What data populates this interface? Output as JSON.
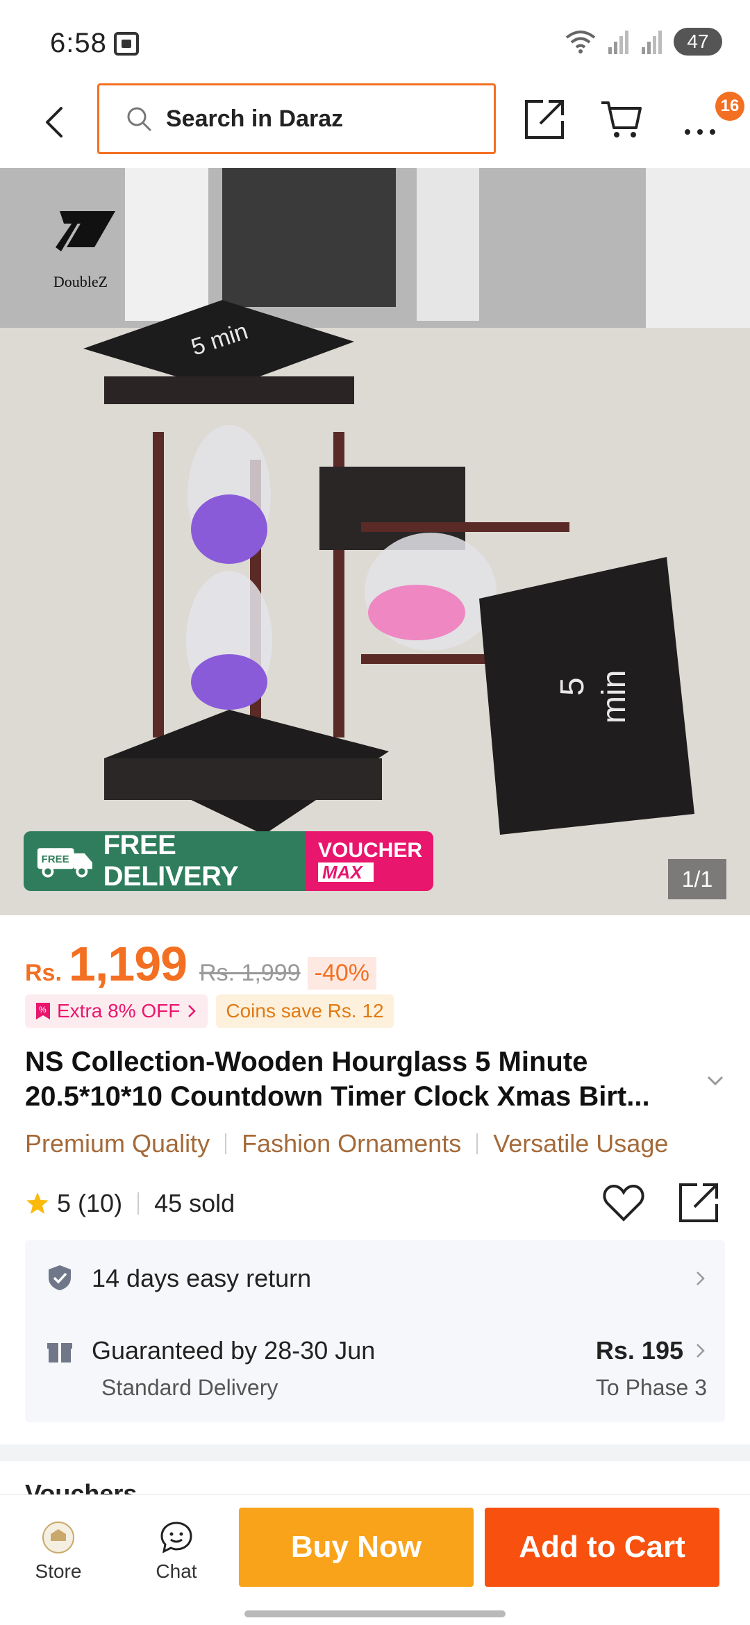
{
  "status_bar": {
    "time": "6:58",
    "battery": "47"
  },
  "header": {
    "search_placeholder": "Search in Daraz",
    "cart_badge": "16"
  },
  "product_image": {
    "brand": "DoubleZ",
    "free_delivery": "FREE DELIVERY",
    "free_tag": "FREE",
    "voucher_line1": "VOUCHER",
    "voucher_line2": "MAX",
    "counter": "1/1"
  },
  "price": {
    "currency": "Rs.",
    "current": "1,199",
    "original": "Rs. 1,999",
    "discount": "-40%"
  },
  "promotions": {
    "extra_off": "Extra 8% OFF",
    "coins": "Coins save Rs. 12"
  },
  "product": {
    "title": "NS Collection-Wooden Hourglass 5 Minute 20.5*10*10 Countdown Timer Clock Xmas Birt...",
    "tags": [
      "Premium Quality",
      "Fashion Ornaments",
      "Versatile Usage"
    ],
    "rating": "5",
    "reviews": "(10)",
    "sold": "45 sold"
  },
  "services": {
    "return_text": "14 days easy return",
    "delivery_text": "Guaranteed by 28-30 Jun",
    "delivery_type": "Standard Delivery",
    "delivery_price": "Rs. 195",
    "delivery_zone": "To Phase 3"
  },
  "next_section": {
    "title": "Vouchers"
  },
  "bottom_bar": {
    "store_label": "Store",
    "chat_label": "Chat",
    "buy_now": "Buy Now",
    "add_to_cart": "Add to Cart"
  },
  "colors": {
    "accent": "#f36f21",
    "buy_now": "#f9a31b",
    "add_to_cart": "#f7500f",
    "free_delivery_green": "#2f7d5c",
    "voucher_pink": "#e9166d",
    "tag_brown": "#a46a3a"
  }
}
